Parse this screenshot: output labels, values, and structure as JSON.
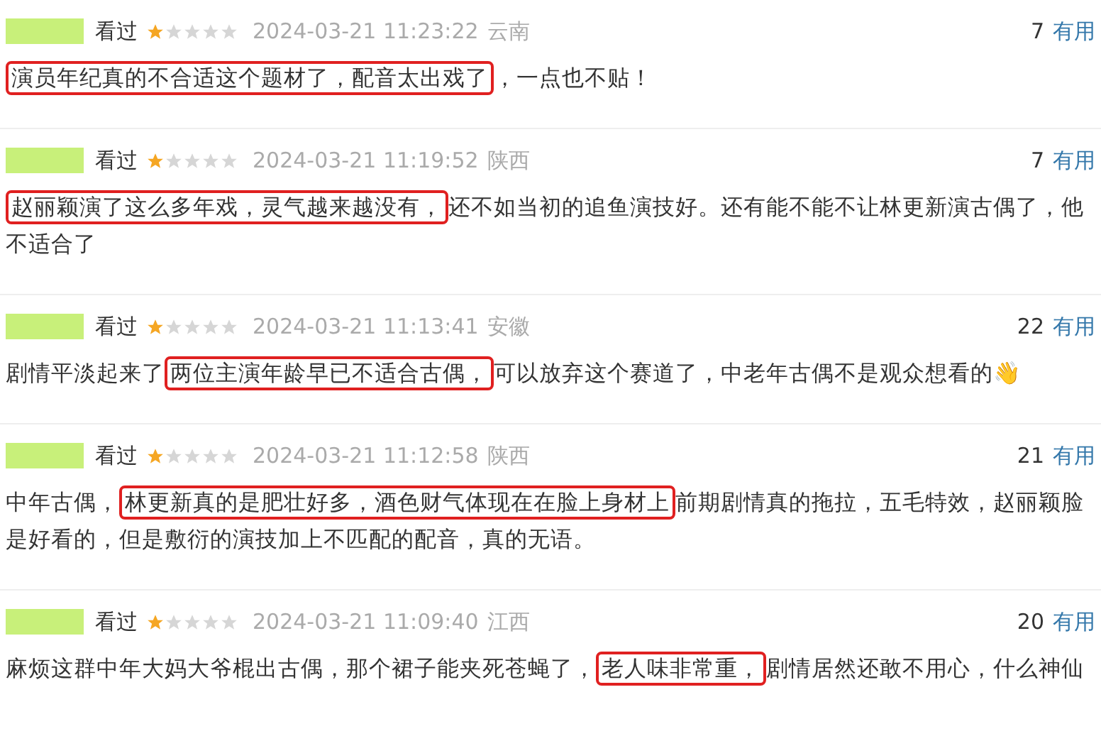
{
  "comments": [
    {
      "status": "看过",
      "stars": 1,
      "time": "2024-03-21 11:23:22",
      "location": "云南",
      "votes": "7",
      "vote_label": "有用",
      "segments": [
        {
          "text": "演员年纪真的不合适这个题材了，配音太出戏了",
          "highlighted": true
        },
        {
          "text": "，一点也不贴！",
          "highlighted": false
        }
      ]
    },
    {
      "status": "看过",
      "stars": 1,
      "time": "2024-03-21 11:19:52",
      "location": "陕西",
      "votes": "7",
      "vote_label": "有用",
      "segments": [
        {
          "text": "赵丽颖演了这么多年戏，灵气越来越没有，",
          "highlighted": true
        },
        {
          "text": "还不如当初的追鱼演技好。还有能不能不让林更新演古偶了，他不适合了",
          "highlighted": false
        }
      ]
    },
    {
      "status": "看过",
      "stars": 1,
      "time": "2024-03-21 11:13:41",
      "location": "安徽",
      "votes": "22",
      "vote_label": "有用",
      "segments": [
        {
          "text": "剧情平淡起来了",
          "highlighted": false
        },
        {
          "text": "两位主演年龄早已不适合古偶，",
          "highlighted": true
        },
        {
          "text": "可以放弃这个赛道了，中老年古偶不是观众想看的👋",
          "highlighted": false
        }
      ]
    },
    {
      "status": "看过",
      "stars": 1,
      "time": "2024-03-21 11:12:58",
      "location": "陕西",
      "votes": "21",
      "vote_label": "有用",
      "segments": [
        {
          "text": "中年古偶，",
          "highlighted": false
        },
        {
          "text": "林更新真的是肥壮好多，酒色财气体现在在脸上身材上",
          "highlighted": true
        },
        {
          "text": "前期剧情真的拖拉，五毛特效，赵丽颖脸是好看的，但是敷衍的演技加上不匹配的配音，真的无语。",
          "highlighted": false
        }
      ]
    },
    {
      "status": "看过",
      "stars": 1,
      "time": "2024-03-21 11:09:40",
      "location": "江西",
      "votes": "20",
      "vote_label": "有用",
      "segments": [
        {
          "text": "麻烦这群中年大妈大爷棍出古偶，那个裙子能夹死苍蝇了，",
          "highlighted": false
        },
        {
          "text": "老人味非常重，",
          "highlighted": true
        },
        {
          "text": "剧情居然还敢不用心，什么神仙",
          "highlighted": false
        }
      ]
    }
  ]
}
